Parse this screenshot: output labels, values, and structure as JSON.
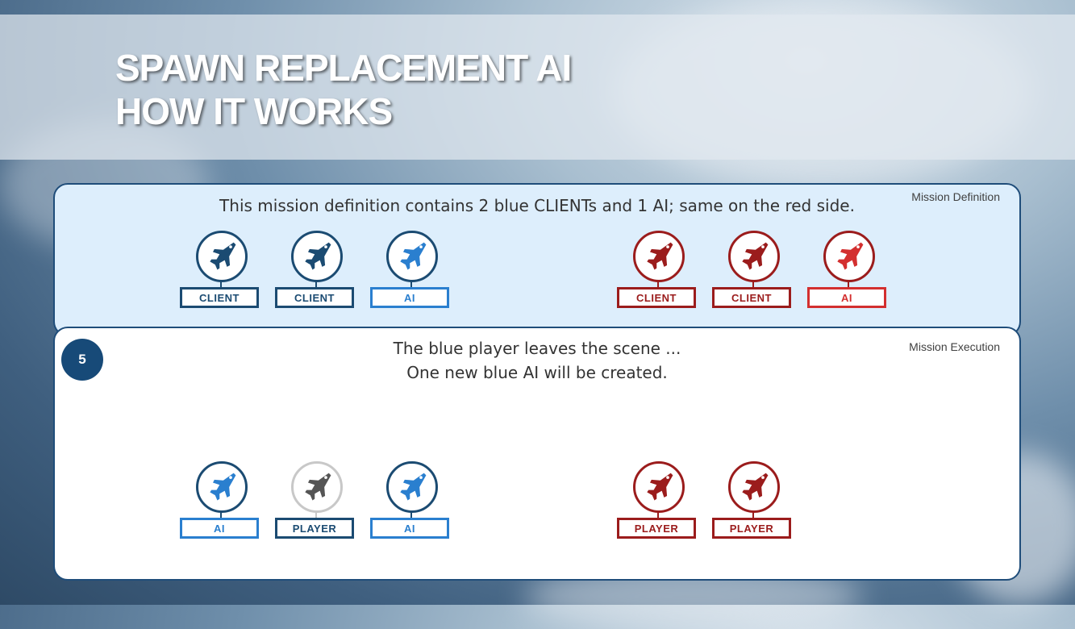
{
  "title": {
    "line1": "SPAWN REPLACEMENT AI",
    "line2": "HOW IT WORKS"
  },
  "definition": {
    "tag": "Mission Definition",
    "text": "This mission definition contains 2 blue CLIENTs and 1 AI; same on the red side.",
    "blue": [
      {
        "label": "CLIENT",
        "color": "#1b4b72",
        "label_color": "#1b4b72"
      },
      {
        "label": "CLIENT",
        "color": "#1b4b72",
        "label_color": "#1b4b72"
      },
      {
        "label": "AI",
        "color": "#2a7fcf",
        "label_color": "#2a7fcf",
        "border": "#1b4b72"
      }
    ],
    "red": [
      {
        "label": "CLIENT",
        "color": "#9b1c1c",
        "label_color": "#9b1c1c"
      },
      {
        "label": "CLIENT",
        "color": "#9b1c1c",
        "label_color": "#9b1c1c"
      },
      {
        "label": "AI",
        "color": "#d32f2f",
        "label_color": "#d32f2f",
        "border": "#9b1c1c"
      }
    ]
  },
  "execution": {
    "tag": "Mission Execution",
    "step": "5",
    "text_line1": "The blue player leaves the scene ...",
    "text_line2": "One new blue AI will be created.",
    "blue": [
      {
        "label": "AI",
        "color": "#2a7fcf",
        "label_color": "#2a7fcf",
        "border": "#1b4b72"
      },
      {
        "label": "PLAYER",
        "color": "#555555",
        "label_color": "#1b4b72",
        "border": "#c8c8c8"
      },
      {
        "label": "AI",
        "color": "#2a7fcf",
        "label_color": "#2a7fcf",
        "border": "#1b4b72"
      }
    ],
    "red": [
      {
        "label": "PLAYER",
        "color": "#9b1c1c",
        "label_color": "#9b1c1c"
      },
      {
        "label": "PLAYER",
        "color": "#9b1c1c",
        "label_color": "#9b1c1c"
      }
    ]
  },
  "icons": {
    "aircraft": "jet-icon"
  }
}
